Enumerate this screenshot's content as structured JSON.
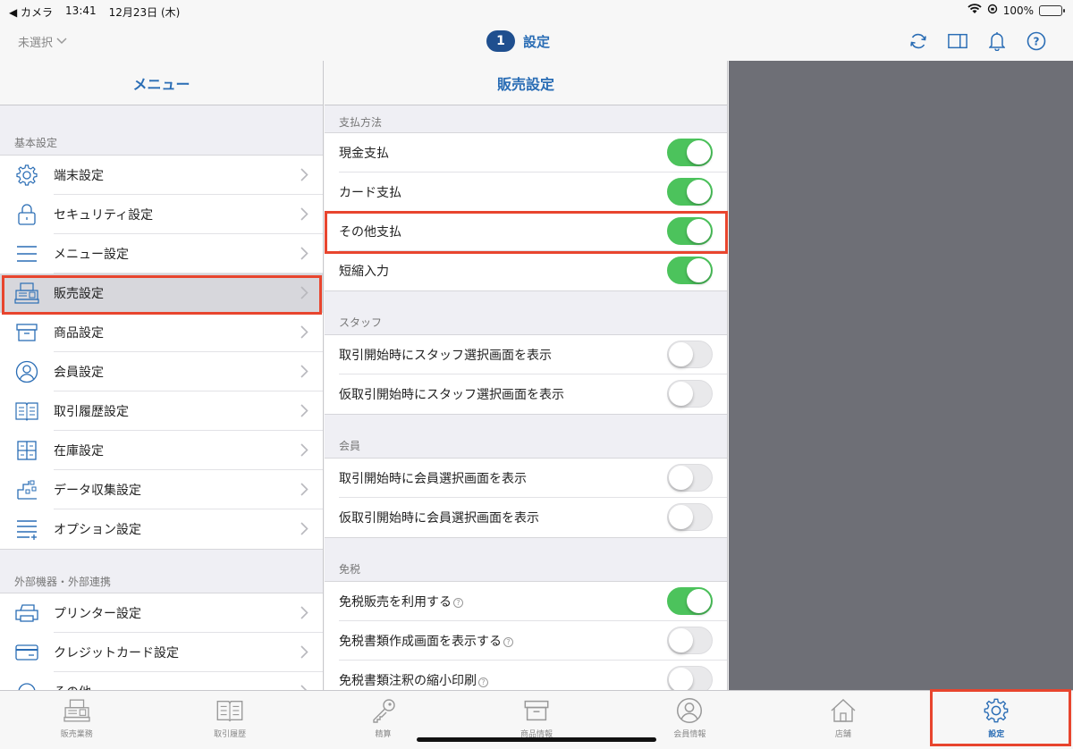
{
  "status_bar": {
    "back_app": "◀ カメラ",
    "time": "13:41",
    "date": "12月23日 (木)",
    "battery": "100%"
  },
  "navbar": {
    "unselected_label": "未選択",
    "badge": "1",
    "title": "設定"
  },
  "menu": {
    "header": "メニュー",
    "sections": [
      {
        "label": "基本設定",
        "items": [
          {
            "label": "端末設定",
            "icon": "gear-icon"
          },
          {
            "label": "セキュリティ設定",
            "icon": "lock-icon"
          },
          {
            "label": "メニュー設定",
            "icon": "list-icon"
          },
          {
            "label": "販売設定",
            "icon": "register-icon",
            "selected": true
          },
          {
            "label": "商品設定",
            "icon": "box-icon"
          },
          {
            "label": "会員設定",
            "icon": "person-icon"
          },
          {
            "label": "取引履歴設定",
            "icon": "book-icon"
          },
          {
            "label": "在庫設定",
            "icon": "shelf-icon"
          },
          {
            "label": "データ収集設定",
            "icon": "data-icon"
          },
          {
            "label": "オプション設定",
            "icon": "list-plus-icon"
          }
        ]
      },
      {
        "label": "外部機器・外部連携",
        "items": [
          {
            "label": "プリンター設定",
            "icon": "printer-icon"
          },
          {
            "label": "クレジットカード設定",
            "icon": "card-icon"
          },
          {
            "label": "その他",
            "icon": "other-icon"
          }
        ]
      }
    ]
  },
  "sales_settings": {
    "header": "販売設定",
    "groups": [
      {
        "label": "支払方法",
        "items": [
          {
            "label": "現金支払",
            "on": true
          },
          {
            "label": "カード支払",
            "on": true
          },
          {
            "label": "その他支払",
            "on": true
          },
          {
            "label": "短縮入力",
            "on": true
          }
        ]
      },
      {
        "label": "スタッフ",
        "items": [
          {
            "label": "取引開始時にスタッフ選択画面を表示",
            "on": false
          },
          {
            "label": "仮取引開始時にスタッフ選択画面を表示",
            "on": false
          }
        ]
      },
      {
        "label": "会員",
        "items": [
          {
            "label": "取引開始時に会員選択画面を表示",
            "on": false
          },
          {
            "label": "仮取引開始時に会員選択画面を表示",
            "on": false
          }
        ]
      },
      {
        "label": "免税",
        "items": [
          {
            "label": "免税販売を利用する",
            "on": true,
            "help": true
          },
          {
            "label": "免税書類作成画面を表示する",
            "on": false,
            "help": true
          },
          {
            "label": "免税書類注釈の縮小印刷",
            "on": false,
            "help": true
          }
        ]
      }
    ]
  },
  "tabbar": {
    "tabs": [
      {
        "label": "販売業務",
        "icon": "register-icon"
      },
      {
        "label": "取引履歴",
        "icon": "book-icon"
      },
      {
        "label": "精算",
        "icon": "key-icon"
      },
      {
        "label": "商品情報",
        "icon": "box-icon"
      },
      {
        "label": "会員情報",
        "icon": "person-icon"
      },
      {
        "label": "店舗",
        "icon": "house-icon"
      },
      {
        "label": "設定",
        "icon": "gear-icon",
        "active": true
      }
    ]
  },
  "colors": {
    "accent": "#2a6db5",
    "toggle_on": "#4cc35c",
    "highlight": "#e8452e",
    "badge": "#1f4f8f"
  }
}
